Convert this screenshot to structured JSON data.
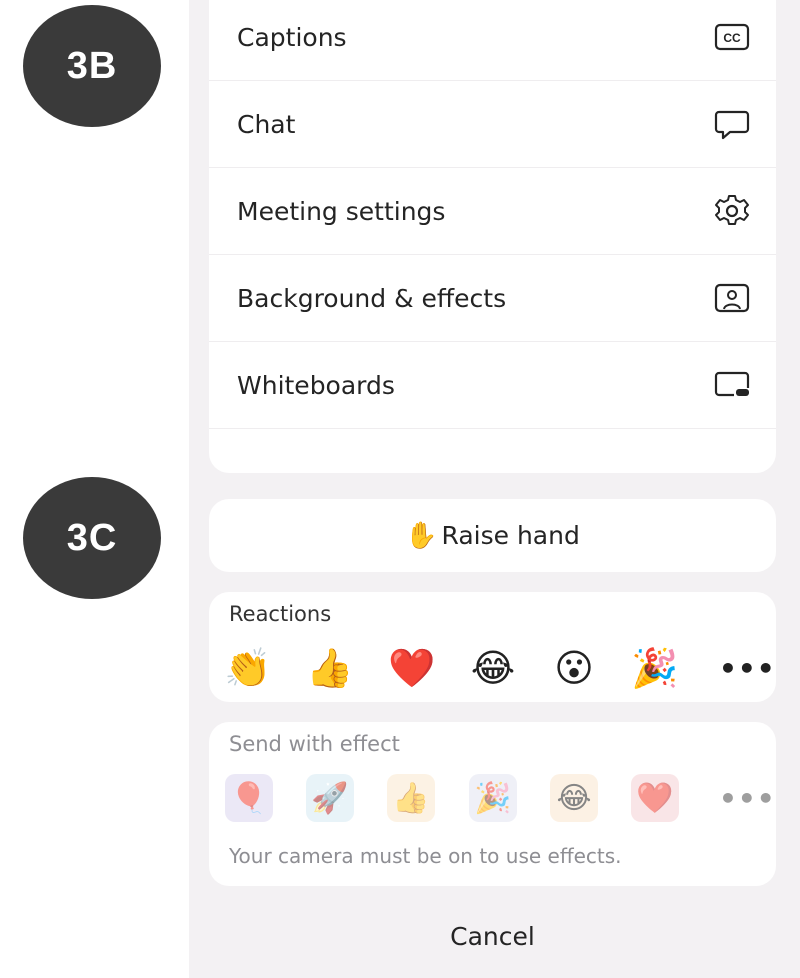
{
  "badges": {
    "top": "3B",
    "bottom": "3C"
  },
  "menu": {
    "items": [
      {
        "label": "Captions",
        "icon": "captions-icon"
      },
      {
        "label": "Chat",
        "icon": "chat-icon"
      },
      {
        "label": "Meeting settings",
        "icon": "gear-icon"
      },
      {
        "label": "Background & effects",
        "icon": "background-effects-icon"
      },
      {
        "label": "Whiteboards",
        "icon": "whiteboard-icon"
      }
    ]
  },
  "raise_hand": {
    "emoji": "✋",
    "label": "Raise hand"
  },
  "reactions": {
    "title": "Reactions",
    "items": [
      {
        "name": "clap",
        "emoji": "👏"
      },
      {
        "name": "thumbs-up",
        "emoji": "👍"
      },
      {
        "name": "heart",
        "emoji": "❤️"
      },
      {
        "name": "laugh",
        "emoji": "😂"
      },
      {
        "name": "surprised",
        "emoji": "😮"
      },
      {
        "name": "celebrate",
        "emoji": "🎉"
      }
    ],
    "more": "•••"
  },
  "effects": {
    "title": "Send with effect",
    "items": [
      {
        "name": "balloon",
        "emoji": "🎈",
        "bg": "#dcd6ef"
      },
      {
        "name": "rocket",
        "emoji": "🚀",
        "bg": "#d6eaf3"
      },
      {
        "name": "thumbs-up",
        "emoji": "👍",
        "bg": "#fbe9cf"
      },
      {
        "name": "confetti",
        "emoji": "🎉",
        "bg": "#e2e4f1"
      },
      {
        "name": "laugh",
        "emoji": "😂",
        "bg": "#fbe6cf"
      },
      {
        "name": "heart",
        "emoji": "❤️",
        "bg": "#f5d0d4"
      }
    ],
    "more": "•••",
    "note": "Your camera must be on to use effects."
  },
  "cancel_label": "Cancel",
  "colors": {
    "sheet_bg": "#f3f1f3",
    "card_bg": "#ffffff",
    "badge_bg": "#3a3a3a"
  }
}
